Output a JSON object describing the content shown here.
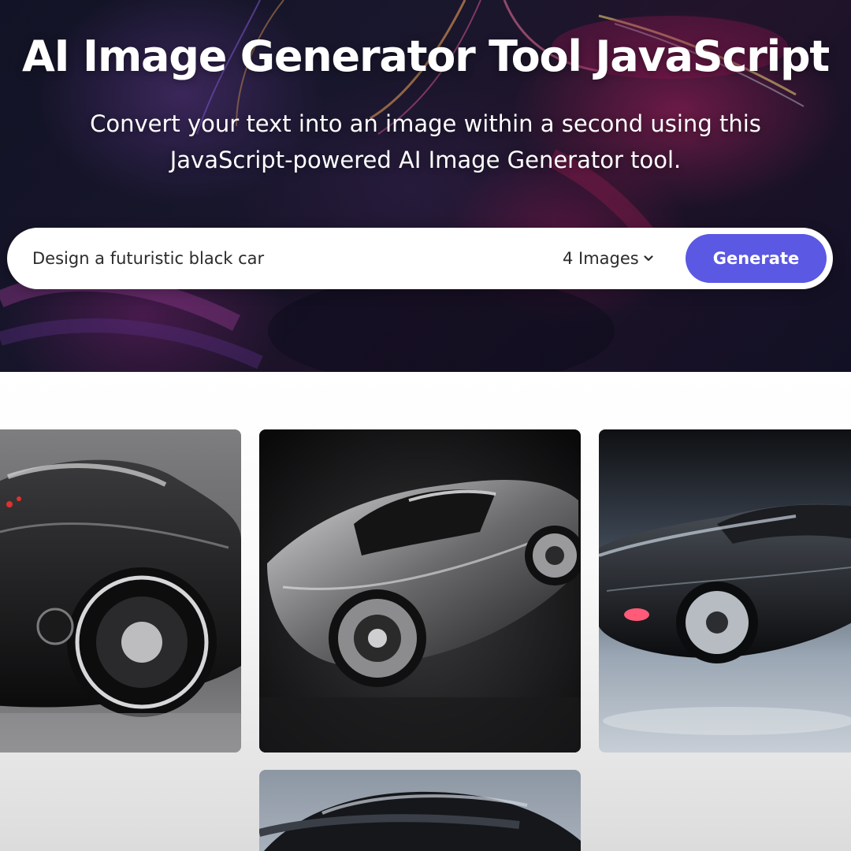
{
  "hero": {
    "title": "AI Image Generator Tool JavaScript",
    "subtitle_line_1": "Convert your text into an image within a second using this",
    "subtitle_line_2": "JavaScript-powered AI Image Generator tool."
  },
  "prompt_form": {
    "input_value": "Design a futuristic black car",
    "image_count": "4 Images",
    "generate_label": "Generate"
  },
  "colors": {
    "accent": "#5b58e3",
    "hero_bg": "#1d1b33"
  },
  "gallery": {
    "image_count": 4
  }
}
